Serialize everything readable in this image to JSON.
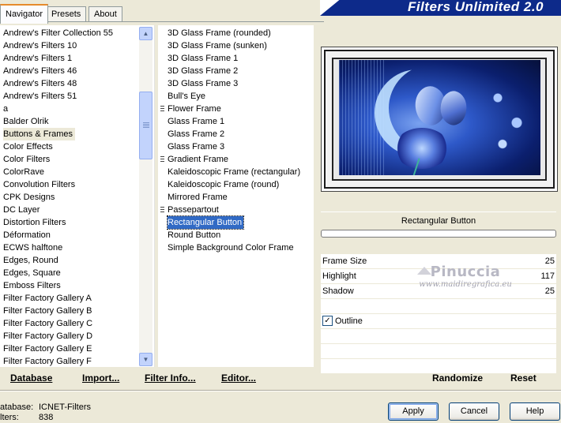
{
  "tabs": [
    "Navigator",
    "Presets",
    "About"
  ],
  "app_title": "Filters Unlimited 2.0",
  "categories": [
    "Andrew's Filter Collection 55",
    "Andrew's Filters 10",
    "Andrew's Filters 1",
    "Andrew's Filters 46",
    "Andrew's Filters 48",
    "Andrew's Filters 51",
    "a",
    "Balder Olrik",
    "Buttons & Frames",
    "Color Effects",
    "Color Filters",
    "ColorRave",
    "Convolution Filters",
    "CPK Designs",
    "DC Layer",
    "Distortion Filters",
    "Déformation",
    "ECWS halftone",
    "Edges, Round",
    "Edges, Square",
    "Emboss Filters",
    "Filter Factory Gallery A",
    "Filter Factory Gallery B",
    "Filter Factory Gallery C",
    "Filter Factory Gallery D",
    "Filter Factory Gallery E",
    "Filter Factory Gallery F"
  ],
  "selected_category": "Buttons & Frames",
  "filters": [
    "3D Glass Frame (rounded)",
    "3D Glass Frame (sunken)",
    "3D Glass Frame 1",
    "3D Glass Frame 2",
    "3D Glass Frame 3",
    "Bull's Eye",
    "Flower Frame",
    "Glass Frame 1",
    "Glass Frame 2",
    "Glass Frame 3",
    "Gradient Frame",
    "Kaleidoscopic Frame (rectangular)",
    "Kaleidoscopic Frame (round)",
    "Mirrored Frame",
    "Passepartout",
    "Rectangular Button",
    "Round Button",
    "Simple Background Color Frame"
  ],
  "filter_markers": [
    "Flower Frame",
    "Gradient Frame",
    "Passepartout"
  ],
  "selected_filter": "Rectangular Button",
  "controls": {
    "filter_name": "Rectangular Button",
    "params": [
      {
        "label": "Frame Size",
        "value": "25"
      },
      {
        "label": "Highlight",
        "value": "117"
      },
      {
        "label": "Shadow",
        "value": "25"
      }
    ],
    "outline_label": "Outline",
    "outline_checked": true,
    "check_mark": "✓"
  },
  "watermark": {
    "name": "Pinuccia",
    "site": "www.maidiregrafica.eu"
  },
  "bottom_links": {
    "database": "Database",
    "import": "Import...",
    "filter_info": "Filter Info...",
    "editor": "Editor..."
  },
  "right_links": {
    "randomize": "Randomize",
    "reset": "Reset"
  },
  "status": {
    "database_label": "atabase:",
    "database_value": "ICNET-Filters",
    "filters_label": "lters:",
    "filters_value": "838"
  },
  "buttons": {
    "apply": "Apply",
    "cancel": "Cancel",
    "help": "Help"
  },
  "icons": {
    "scroll_up": "▲",
    "scroll_down": "▼"
  }
}
